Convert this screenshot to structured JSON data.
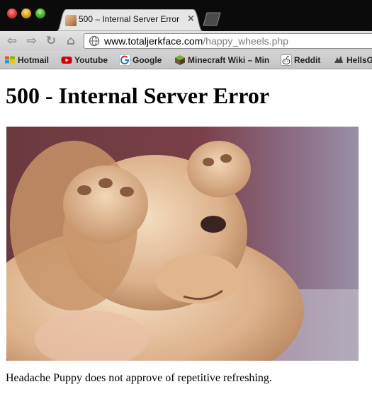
{
  "window": {
    "tab": {
      "title": "500 – Internal Server Error",
      "close_glyph": "×"
    }
  },
  "toolbar": {
    "back_glyph": "⇦",
    "forward_glyph": "⇨",
    "reload_glyph": "↻",
    "home_glyph": "⌂",
    "url_domain": "www.totaljerkface.com",
    "url_path": "/happy_wheels.php"
  },
  "bookmarks": [
    {
      "label": "Hotmail",
      "icon": "windows-flag-icon"
    },
    {
      "label": "Youtube",
      "icon": "youtube-play-icon"
    },
    {
      "label": "Google",
      "icon": "google-g-icon"
    },
    {
      "label": "Minecraft Wiki – Minecraft",
      "icon": "minecraft-block-icon"
    },
    {
      "label": "Reddit",
      "icon": "reddit-alien-icon"
    },
    {
      "label": "HellsG",
      "icon": "hells-icon"
    }
  ],
  "page": {
    "heading": "500 - Internal Server Error",
    "image_subject": "puppy covering its face with its paws",
    "caption": "Headache Puppy does not approve of repetitive refreshing."
  },
  "colors": {
    "tabstrip": "#0b0b0b",
    "toolbar": "#d8d8d8",
    "url_path": "#7b7b7b"
  }
}
